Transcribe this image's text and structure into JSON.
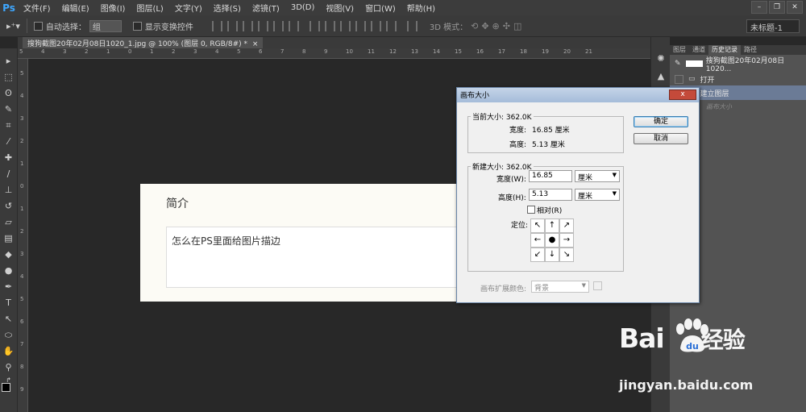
{
  "app": {
    "logo": "Ps"
  },
  "menu": [
    "文件(F)",
    "编辑(E)",
    "图像(I)",
    "图层(L)",
    "文字(Y)",
    "选择(S)",
    "滤镜(T)",
    "3D(D)",
    "视图(V)",
    "窗口(W)",
    "帮助(H)"
  ],
  "window_controls": {
    "minimize": "–",
    "restore": "❐",
    "close": "✕"
  },
  "options_bar": {
    "auto_select_label": "自动选择：",
    "auto_select_value": "组",
    "show_transform_label": "显示变换控件",
    "mode_3d_label": "3D 模式：",
    "workspace": "未标题-1"
  },
  "document_tab": {
    "title": "搜狗截图20年02月08日1020_1.jpg @ 100% (图层 0, RGB/8#) *",
    "close": "×"
  },
  "ruler": {
    "top_ticks": [
      "5",
      "4",
      "3",
      "2",
      "1",
      "0",
      "1",
      "2",
      "3",
      "4",
      "5",
      "6",
      "7",
      "8",
      "9",
      "10",
      "11",
      "12",
      "13",
      "14",
      "15",
      "16",
      "17",
      "18",
      "19",
      "20",
      "21"
    ],
    "left_ticks": [
      "5",
      "4",
      "3",
      "2",
      "1",
      "0",
      "1",
      "2",
      "3",
      "4",
      "5",
      "6",
      "7",
      "8",
      "9"
    ]
  },
  "document_content": {
    "heading": "简介",
    "body": "怎么在PS里面给图片描边"
  },
  "panel": {
    "tabs": [
      "图层",
      "通道",
      "历史记录",
      "路径"
    ],
    "active_tab": "历史记录",
    "history": [
      {
        "label": "搜狗截图20年02月08日1020...",
        "type": "snapshot"
      },
      {
        "label": "打开",
        "type": "step"
      },
      {
        "label": "建立图层",
        "type": "step",
        "selected": true
      },
      {
        "label": "画布大小",
        "type": "step",
        "dimmed": true
      }
    ]
  },
  "dialog": {
    "title": "画布大小",
    "close_label": "x",
    "current_size_label": "当前大小: 362.0K",
    "current_width_label": "宽度:",
    "current_width_value": "16.85 厘米",
    "current_height_label": "高度:",
    "current_height_value": "5.13 厘米",
    "new_size_label": "新建大小: 362.0K",
    "new_width_label": "宽度(W):",
    "new_width_value": "16.85",
    "new_width_unit": "厘米",
    "new_height_label": "高度(H):",
    "new_height_value": "5.13",
    "new_height_unit": "厘米",
    "relative_label": "相对(R)",
    "anchor_label": "定位:",
    "anchor_arrows": [
      "↖",
      "↑",
      "↗",
      "←",
      "●",
      "→",
      "↙",
      "↓",
      "↘"
    ],
    "extension_color_label": "画布扩展颜色:",
    "extension_color_value": "背景",
    "ok_label": "确定",
    "cancel_label": "取消"
  },
  "watermark": {
    "logo_text_left": "Bai",
    "logo_text_right": "经验",
    "url": "jingyan.baidu.com"
  },
  "colors": {
    "canvas_bg": "#282828",
    "panel_bg": "#535353",
    "selected_history": "#6b7b96",
    "dialog_bg": "#f0f0f0"
  }
}
